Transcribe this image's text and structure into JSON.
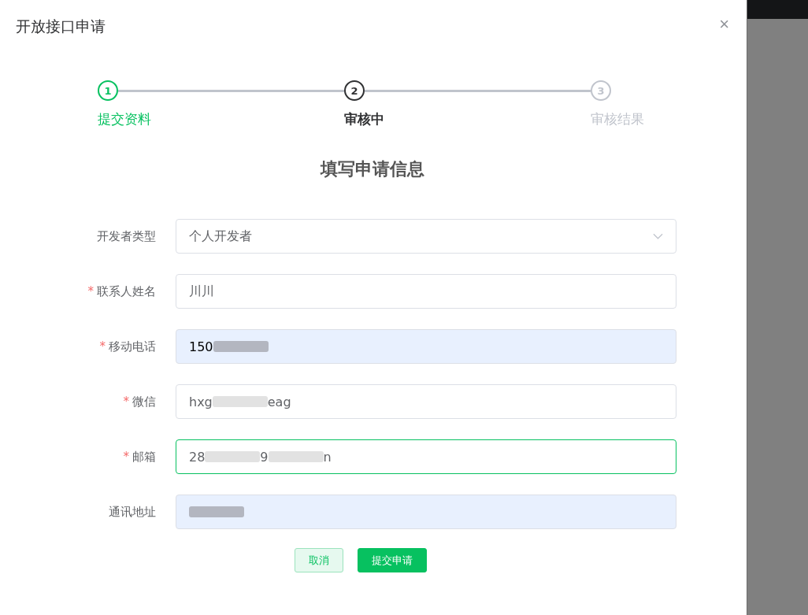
{
  "dialog": {
    "title": "开放接口申请",
    "close": "×"
  },
  "steps": [
    {
      "number": "1",
      "label": "提交资料",
      "completed": true,
      "active": false
    },
    {
      "number": "2",
      "label": "审核中",
      "completed": false,
      "active": true
    },
    {
      "number": "3",
      "label": "审核结果",
      "completed": false,
      "active": false
    }
  ],
  "heading": "填写申请信息",
  "fields": [
    {
      "kind": "select",
      "label": "开发者类型",
      "value": [
        {
          "kind": "text",
          "text": "个人开发者"
        }
      ],
      "autofilled": false,
      "focused": false
    },
    {
      "kind": "input",
      "required_mark": "*",
      "label": "联系人姓名",
      "value": [
        {
          "kind": "text",
          "text": "川川"
        }
      ],
      "autofilled": false,
      "focused": false
    },
    {
      "kind": "input",
      "required_mark": "*",
      "label": "移动电话",
      "value": [
        {
          "kind": "text",
          "text": "150"
        },
        {
          "kind": "blur"
        }
      ],
      "autofilled": true,
      "focused": false
    },
    {
      "kind": "input",
      "required_mark": "*",
      "label": "微信",
      "value": [
        {
          "kind": "text",
          "text": "hxg"
        },
        {
          "kind": "blur"
        },
        {
          "kind": "text",
          "text": "eag"
        }
      ],
      "autofilled": false,
      "focused": false
    },
    {
      "kind": "input",
      "required_mark": "*",
      "label": "邮箱",
      "value": [
        {
          "kind": "text",
          "text": "28"
        },
        {
          "kind": "blur"
        },
        {
          "kind": "text",
          "text": "9"
        },
        {
          "kind": "blur"
        },
        {
          "kind": "text",
          "text": "n"
        }
      ],
      "autofilled": false,
      "focused": true
    },
    {
      "kind": "input",
      "label": "通讯地址",
      "value": [
        {
          "kind": "blur"
        }
      ],
      "autofilled": true,
      "focused": false
    }
  ],
  "buttons": [
    {
      "label": "取消",
      "kind": "secondary"
    },
    {
      "label": "提交申请",
      "kind": "primary"
    }
  ]
}
